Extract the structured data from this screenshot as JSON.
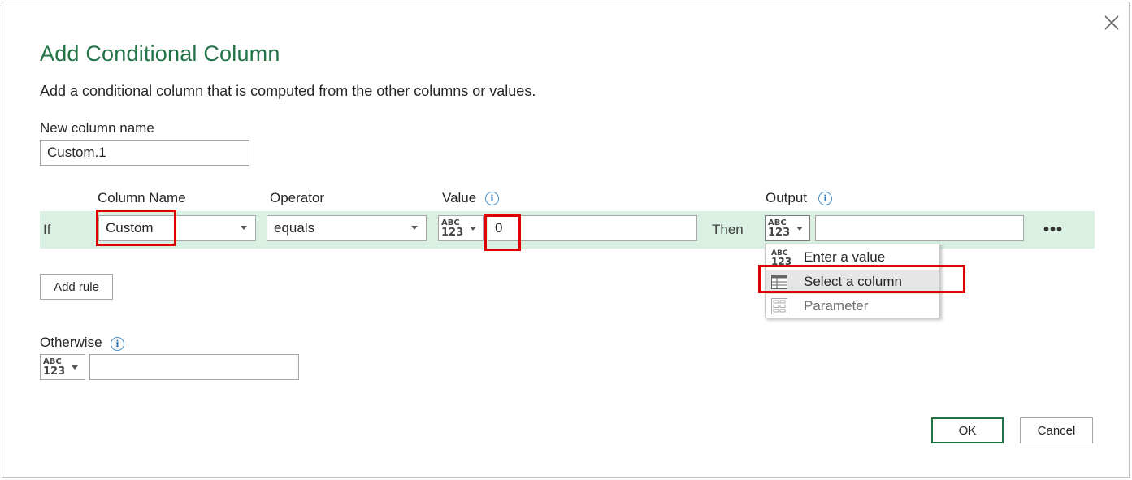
{
  "dialog": {
    "title": "Add Conditional Column",
    "subtitle": "Add a conditional column that is computed from the other columns or values."
  },
  "new_column": {
    "label": "New column name",
    "value": "Custom.1"
  },
  "rule_headers": {
    "column_name": "Column Name",
    "operator": "Operator",
    "value": "Value",
    "output": "Output"
  },
  "rule": {
    "if_label": "If",
    "column": "Custom",
    "operator": "equals",
    "type_abc": "ABC",
    "type_num": "123",
    "value": "0",
    "then_label": "Then",
    "output_value": "",
    "more_glyph": "•••"
  },
  "output_type_menu": {
    "items": [
      {
        "label": "Enter a value",
        "icon": "abc-123-icon"
      },
      {
        "label": "Select a column",
        "icon": "table-column-icon"
      },
      {
        "label": "Parameter",
        "icon": "parameter-icon"
      }
    ]
  },
  "add_rule": {
    "label": "Add rule"
  },
  "otherwise": {
    "label": "Otherwise",
    "value": ""
  },
  "info_glyph": "i",
  "footer": {
    "ok_label": "OK",
    "cancel_label": "Cancel"
  },
  "colors": {
    "accent": "#217346",
    "rule_band": "#d9f0e3",
    "highlight": "#e00000"
  }
}
